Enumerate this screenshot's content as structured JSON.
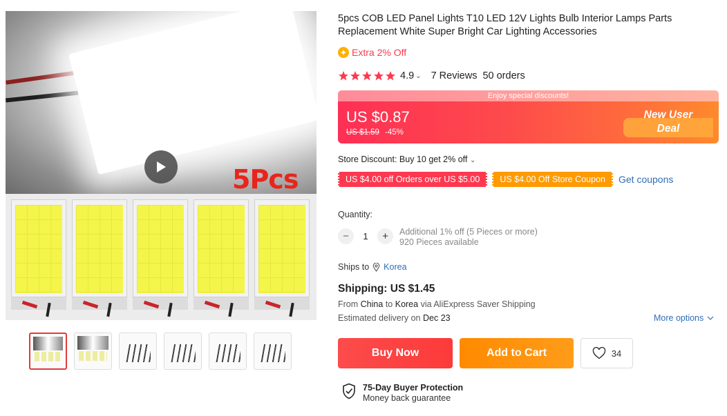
{
  "gallery": {
    "overlay_text": "5Pcs",
    "thumbnails": [
      "thumb-1",
      "thumb-2",
      "thumb-3",
      "thumb-4",
      "thumb-5",
      "thumb-6"
    ],
    "selected_thumbnail": 1
  },
  "product": {
    "title": "5pcs COB LED Panel Lights T10 LED 12V Lights Bulb Interior Lamps Parts Replacement White Super Bright Car Lighting Accessories",
    "extra_discount": "Extra 2% Off",
    "rating": "4.9",
    "stars": 5,
    "reviews": "7 Reviews",
    "orders": "50 orders"
  },
  "price": {
    "banner": "Enjoy special discounts!",
    "current": "US $0.87",
    "original": "US $1.59",
    "discount": "-45%",
    "deal_line1": "New User",
    "deal_line2": "Deal"
  },
  "store": {
    "discount": "Store Discount: Buy 10 get 2% off",
    "coupon1": "US $4.00 off Orders over US $5.00",
    "coupon2": "US $4.00 Off Store Coupon",
    "get_coupons": "Get coupons"
  },
  "quantity": {
    "label": "Quantity:",
    "minus": "−",
    "value": "1",
    "plus": "+",
    "additional": "Additional 1% off (5 Pieces or more)",
    "available": "920 Pieces available"
  },
  "shipping": {
    "ships_to_label": "Ships to",
    "ships_to": "Korea",
    "cost": "Shipping: US $1.45",
    "from_label": "From",
    "from": "China",
    "to_label": "to",
    "to": "Korea",
    "via": "via AliExpress Saver Shipping",
    "delivery_label": "Estimated delivery on",
    "delivery_date": "Dec 23",
    "more_options": "More options"
  },
  "actions": {
    "buy_now": "Buy Now",
    "add_to_cart": "Add to Cart",
    "wishlist_count": "34"
  },
  "protection": {
    "title": "75-Day Buyer Protection",
    "subtitle": "Money back guarantee"
  },
  "colors": {
    "accent_red": "#fd384f",
    "accent_orange": "#ff9a00",
    "link_blue": "#2e6db8",
    "star": "#fd384f"
  }
}
